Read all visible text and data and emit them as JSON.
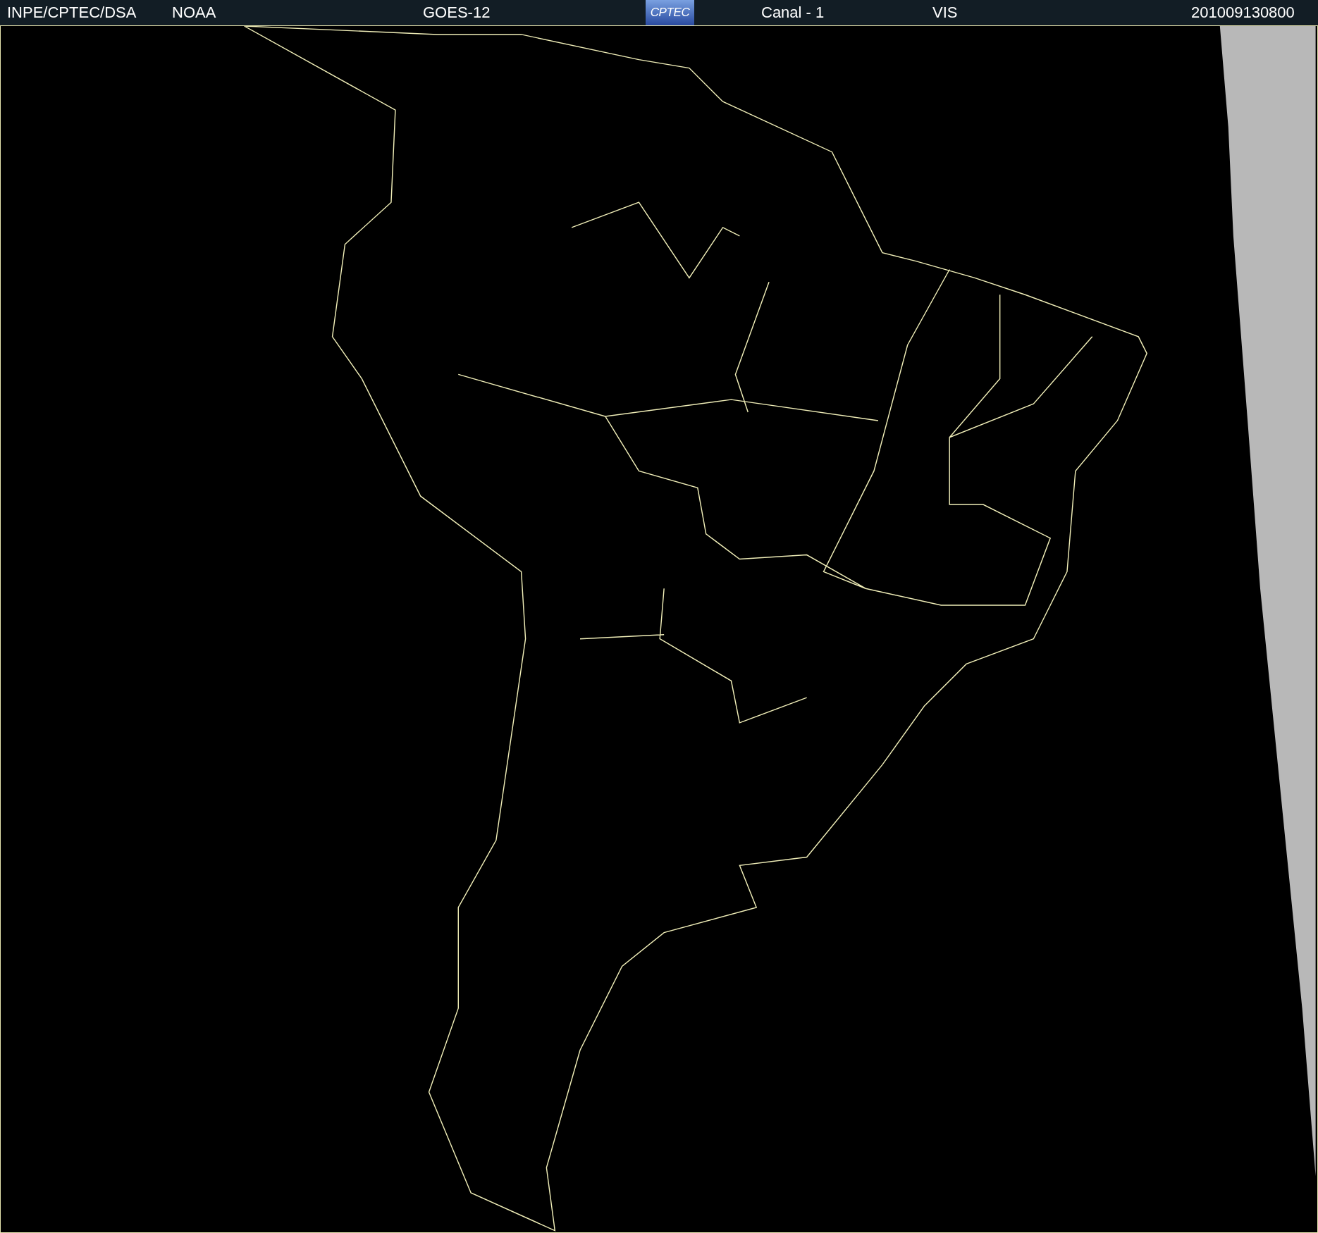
{
  "header": {
    "items": [
      {
        "kind": "text",
        "text": "INPE/CPTEC/DSA"
      },
      {
        "kind": "text",
        "text": "NOAA"
      },
      {
        "kind": "text",
        "text": "GOES-12"
      },
      {
        "kind": "logo",
        "text": "CPTEC"
      },
      {
        "kind": "text",
        "text": "Canal - 1"
      },
      {
        "kind": "text",
        "text": "VIS"
      },
      {
        "kind": "text",
        "text": "201009130800"
      }
    ]
  }
}
